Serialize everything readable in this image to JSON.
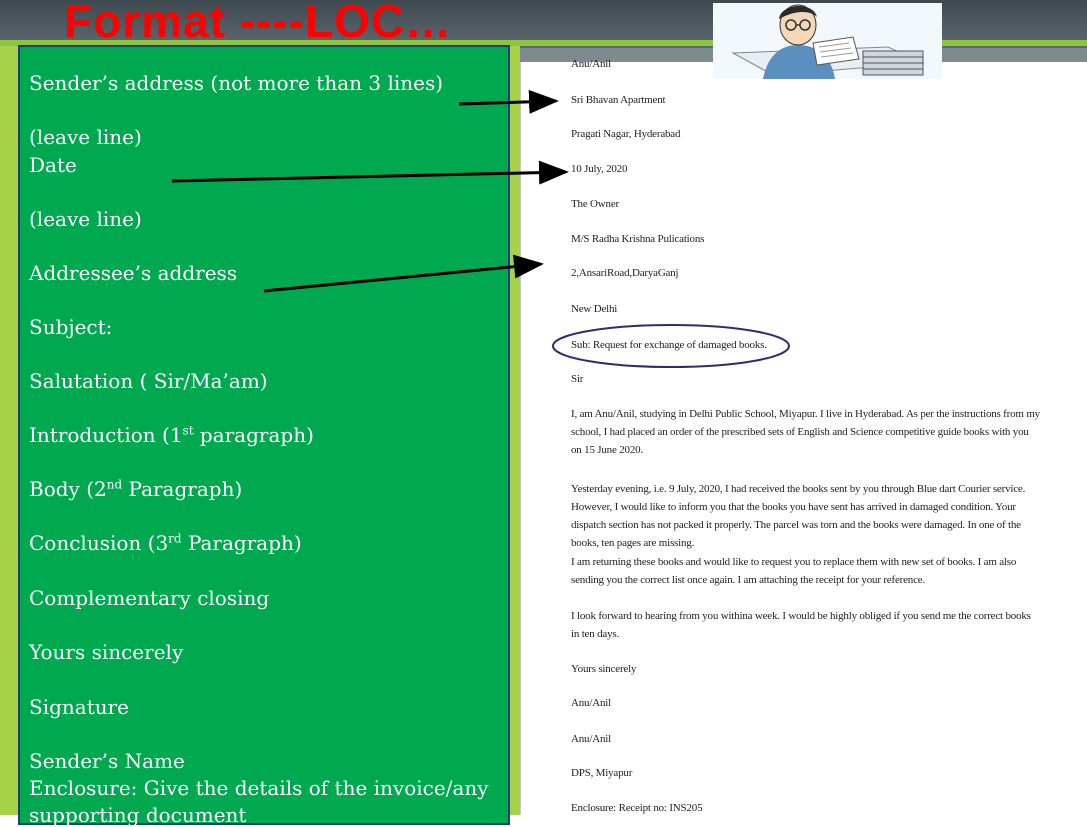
{
  "title": "Format ----LOC…",
  "format_lines": [
    {
      "text": "Sender’s address (not more than 3 lines)"
    },
    {
      "text": "(leave line)"
    },
    {
      "text": "Date"
    },
    {
      "text": "(leave line)"
    },
    {
      "text": "Addressee’s address"
    },
    {
      "text": "Subject:"
    },
    {
      "text": "Salutation ( Sir/Ma’am)"
    },
    {
      "pre": "Introduction (1",
      "sup": "st",
      "post": " paragraph)"
    },
    {
      "pre": "Body (2",
      "sup": "nd",
      "post": " Paragraph)"
    },
    {
      "pre": "Conclusion (3",
      "sup": "rd",
      "post": " Paragraph)"
    },
    {
      "text": "Complementary closing"
    },
    {
      "text": "Yours sincerely"
    },
    {
      "text": "Signature"
    },
    {
      "text": "Sender’s  Name"
    },
    {
      "text": "Enclosure: Give the details of the invoice/any"
    },
    {
      "text": "supporting document"
    }
  ],
  "letter": {
    "sender_name_top": "Anu/Anil",
    "sender_address_1": "Sri Bhavan Apartment",
    "sender_address_2": "Pragati Nagar, Hyderabad",
    "date": "10 July, 2020",
    "addressee_1": "The Owner",
    "addressee_2": "M/S Radha Krishna Pulications",
    "addressee_3": "2,AnsariRoad,DaryaGanj",
    "addressee_4": "New Delhi",
    "subject": "Sub: Request for exchange of damaged books.",
    "salutation": "Sir",
    "para1": "I, am Anu/Anil, studying in Delhi Public School, Miyapur. I live in Hyderabad. As per the instructions from my school, I had placed an order of the prescribed sets of English and Science competitive guide books with you on 15 June 2020.",
    "para2": "Yesterday evening, i.e. 9 July, 2020, I had received the books sent by you through Blue dart Courier service. However, I would like to inform you that the books  you have sent has arrived in damaged condition. Your dispatch section has not packed it properly. The parcel was torn and the books were damaged. In one of the books, ten pages are missing.",
    "para3": "I am returning these books and would like to request you to replace them with new set of books. I am also sending you the correct list once again.  I am attaching the receipt for your reference.",
    "para4": "I look forward to hearing from you withina week. I would be highly obliged  if you send me the correct books in ten days.",
    "closing": "Yours sincerely",
    "signature": "Anu/Anil",
    "sender_name": "Anu/Anil",
    "school": "DPS, Miyapur",
    "enclosure": "Enclosure: Receipt no: INS205"
  },
  "illustration": "student-reading-icon",
  "colors": {
    "title": "#ff0000",
    "green_box": "#00a850",
    "accent_green": "#a6d24a",
    "ellipse": "#2b2f6b"
  }
}
